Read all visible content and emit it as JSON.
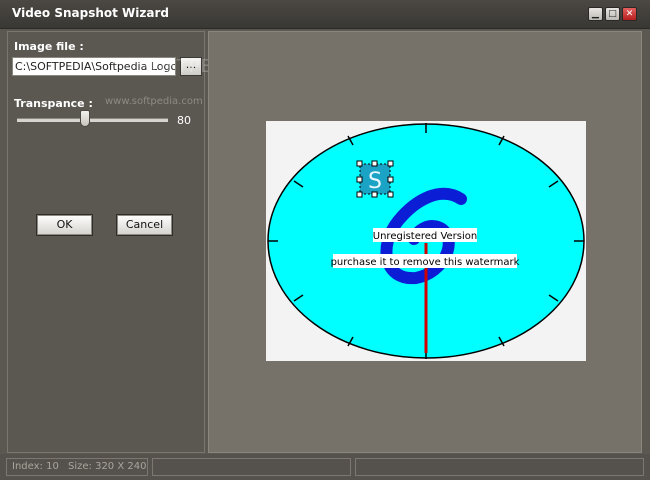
{
  "window": {
    "title": "Video Snapshot Wizard"
  },
  "titlebar_buttons": {
    "minimize": "▁",
    "maximize": "□",
    "close": "✕"
  },
  "form": {
    "image_file_label": "Image file :",
    "image_file_value": "C:\\SOFTPEDIA\\Softpedia Logo.ic",
    "browse_label": "...",
    "transparence_label": "Transpance :",
    "transparence_value": "80",
    "transparence_fraction": 0.8,
    "ok_label": "OK",
    "cancel_label": "Cancel"
  },
  "watermarks": {
    "brand": "SOFTPEDIA",
    "url": "www.softpedia.com"
  },
  "preview": {
    "overlay_letter": "S",
    "unregistered": "Unregistered Version",
    "purchase_note": "purchase it to remove this watermark"
  },
  "status": {
    "index": "Index: 10",
    "size": "Size: 320 X 240",
    "panel2": "",
    "panel3": ""
  }
}
